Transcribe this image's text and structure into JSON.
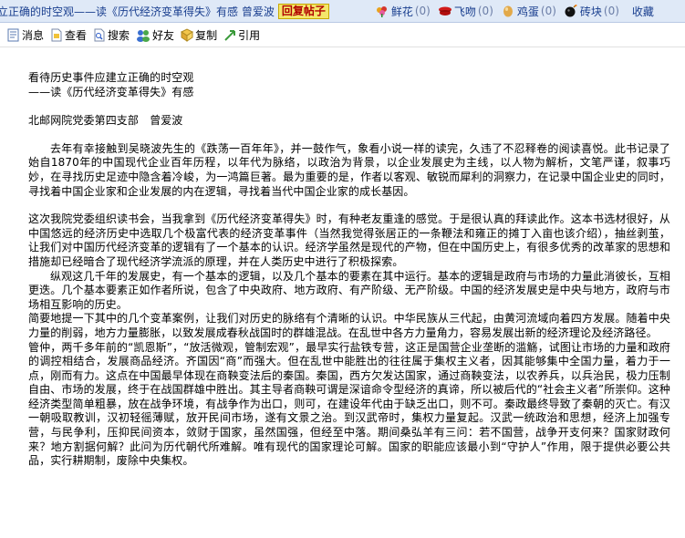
{
  "titlebar": {
    "title": "立正确的时空观——读《历代经济变革得失》有感 曾爱波",
    "reply_label": "回复帖子",
    "gifts": [
      {
        "label": "鲜花",
        "count": "(0)"
      },
      {
        "label": "飞吻",
        "count": "(0)"
      },
      {
        "label": "鸡蛋",
        "count": "(0)"
      },
      {
        "label": "砖块",
        "count": "(0)"
      }
    ],
    "favorite_label": "收藏"
  },
  "toolbar": {
    "items": [
      {
        "label": "消息",
        "icon": "message-icon"
      },
      {
        "label": "查看",
        "icon": "view-icon"
      },
      {
        "label": "搜索",
        "icon": "search-icon"
      },
      {
        "label": "好友",
        "icon": "friends-icon"
      },
      {
        "label": "复制",
        "icon": "copy-icon"
      },
      {
        "label": "引用",
        "icon": "quote-icon"
      }
    ]
  },
  "article": {
    "title_line1": "看待历史事件应建立正确的时空观",
    "title_line2": "——读《历代经济变革得失》有感",
    "author": "北邮网院党委第四支部　曾爱波",
    "p1": "去年有幸接触到吴晓波先生的《跌荡一百年年》，并一鼓作气，象看小说一样的读完，久违了不忍释卷的阅读喜悦。此书记录了始自1870年的中国现代企业百年历程，以年代为脉络，以政治为背景，以企业发展史为主线，以人物为解析，文笔严谨，叙事巧妙，在寻找历史足迹中隐含着冷峻，为一鸿篇巨著。最为重要的是，作者以客观、敏锐而犀利的洞察力，在记录中国企业史的同时，寻找着中国企业家和企业发展的内在逻辑，寻找着当代中国企业家的成长基因。",
    "p2": "这次我院党委组织读书会，当我拿到《历代经济变革得失》时，有种老友重逢的感觉。于是很认真的拜读此作。这本书选材很好，从中国悠远的经济历史中选取几个极富代表的经济变革事件（当然我觉得张居正的一条鞭法和雍正的摊丁入亩也该介绍），抽丝剥茧，让我们对中国历代经济变革的逻辑有了一个基本的认识。经济学虽然是现代的产物，但在中国历史上，有很多优秀的改革家的思想和措施却已经暗合了现代经济学流派的原理，并在人类历史中进行了积极探索。",
    "p3": "纵观这几千年的发展史，有一个基本的逻辑，以及几个基本的要素在其中运行。基本的逻辑是政府与市场的力量此消彼长，互相更迭。几个基本要素正如作者所说，包含了中央政府、地方政府、有产阶级、无产阶级。中国的经济发展史是中央与地方，政府与市场相互影响的历史。",
    "p4": "简要地提一下其中的几个变革案例，让我们对历史的脉络有个清晰的认识。中华民族从三代起，由黄河流域向着四方发展。随着中央力量的削弱，地方力量膨胀，以致发展成春秋战国时的群雄混战。在乱世中各方力量角力，容易发展出新的经济理论及经济路径。",
    "p5": "管仲，两千多年前的“凯恩斯”，“放活微观，管制宏观”，最早实行盐铁专营，这正是国营企业垄断的滥觞，试图让市场的力量和政府的调控相结合，发展商品经济。齐国因“商”而强大。但在乱世中能胜出的往往属于集权主义者，因其能够集中全国力量，着力于一点，刚而有力。这点在中国最早体现在商鞅变法后的秦国。秦国，西方欠发达国家，通过商鞅变法，以农养兵，以兵治民，极力压制自由、市场的发展，终于在战国群雄中胜出。其主导者商鞅可谓是深谙命令型经济的真谛，所以被后代的“社会主义者”所崇仰。这种经济类型简单粗暴，放在战争环境，有战争作为出口，则可，在建设年代由于缺乏出口，则不可。秦政最终导致了秦朝的灭亡。有汉一朝吸取教训，汉初轻徭薄赋，放开民间市场，遂有文景之治。到汉武帝时，集权力量复起。汉武一统政治和思想，经济上加强专营，与民争利，压抑民间资本，敛财于国家，虽然国强，但经至中落。期间桑弘羊有三问：若不国营，战争开支何来？国家财政何来？地方割据何解？此问为历代朝代所难解。唯有现代的国家理论可解。国家的职能应该最小到“守护人”作用，限于提供必要公共品，实行耕期制，废除中央集权。"
  }
}
